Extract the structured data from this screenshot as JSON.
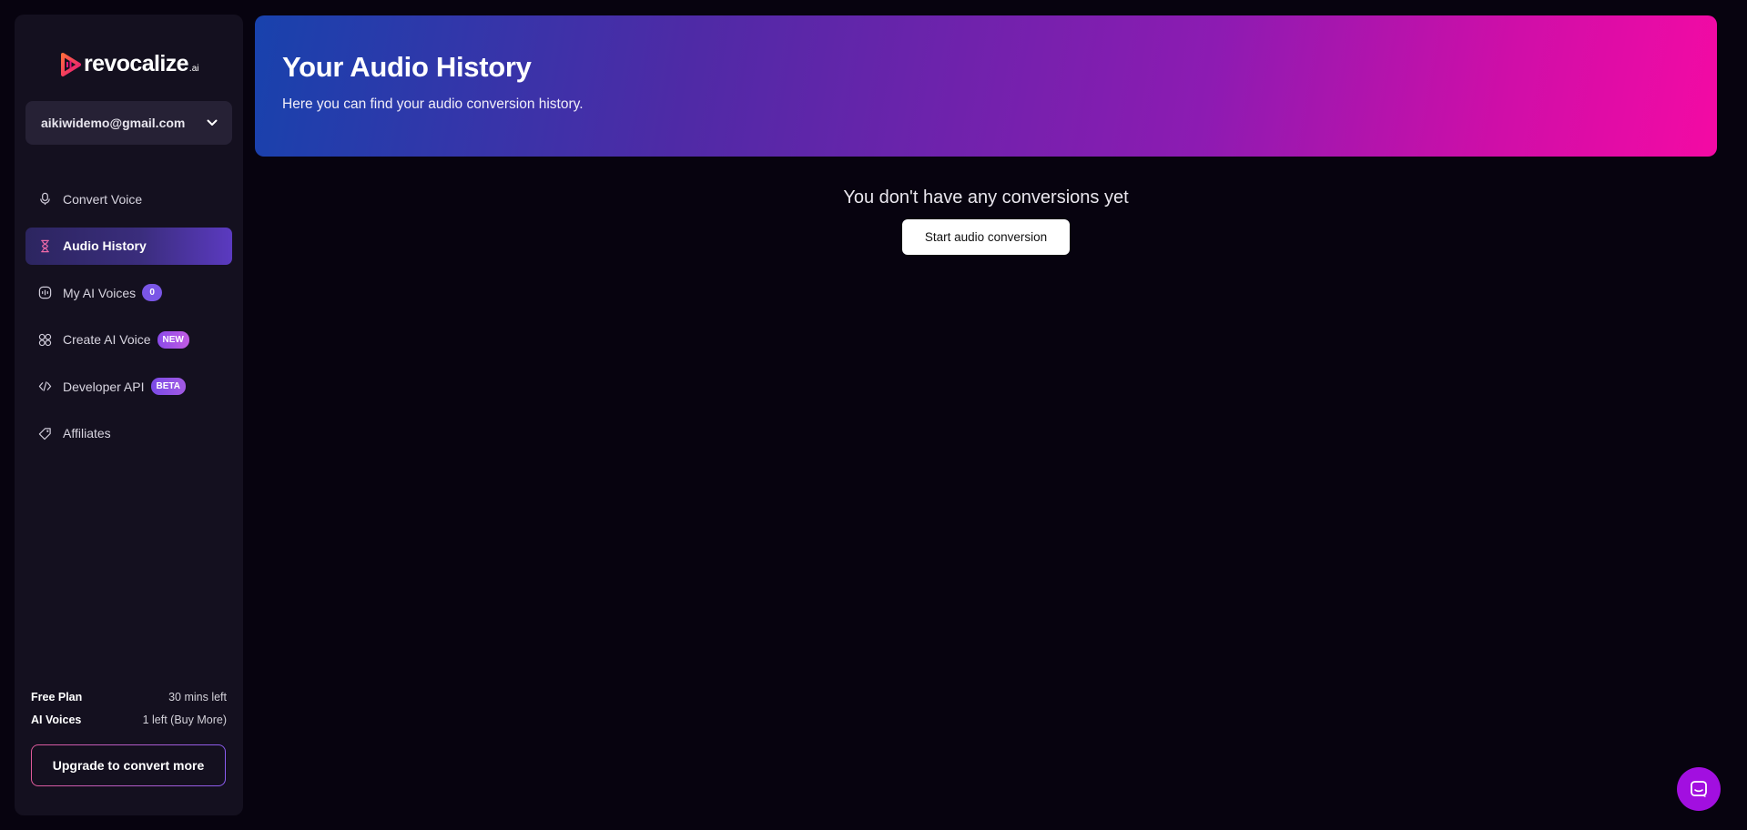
{
  "brand": {
    "name": "revocalize",
    "suffix": ".ai"
  },
  "account": {
    "email": "aikiwidemo@gmail.com"
  },
  "nav": [
    {
      "label": "Convert Voice",
      "icon": "microphone-icon"
    },
    {
      "label": "Audio History",
      "icon": "hourglass-icon",
      "active": true
    },
    {
      "label": "My AI Voices",
      "icon": "voice-wave-icon",
      "badge": "0"
    },
    {
      "label": "Create AI Voice",
      "icon": "atom-icon",
      "badge": "NEW"
    },
    {
      "label": "Developer API",
      "icon": "code-icon",
      "badge": "BETA"
    },
    {
      "label": "Affiliates",
      "icon": "tag-icon"
    }
  ],
  "plan": {
    "free_plan_label": "Free Plan",
    "free_plan_value": "30 mins left",
    "ai_voices_label": "AI Voices",
    "ai_voices_value": "1 left (Buy More)"
  },
  "upgrade_button": "Upgrade to convert more",
  "header": {
    "title": "Your Audio History",
    "subtitle": "Here you can find your audio conversion history."
  },
  "empty_state": {
    "message": "You don't have any conversions yet",
    "button": "Start audio conversion"
  },
  "colors": {
    "background": "#07030f",
    "sidebar": "#14101f",
    "accent": "#7a56e6",
    "chat": "#a20fe0"
  }
}
